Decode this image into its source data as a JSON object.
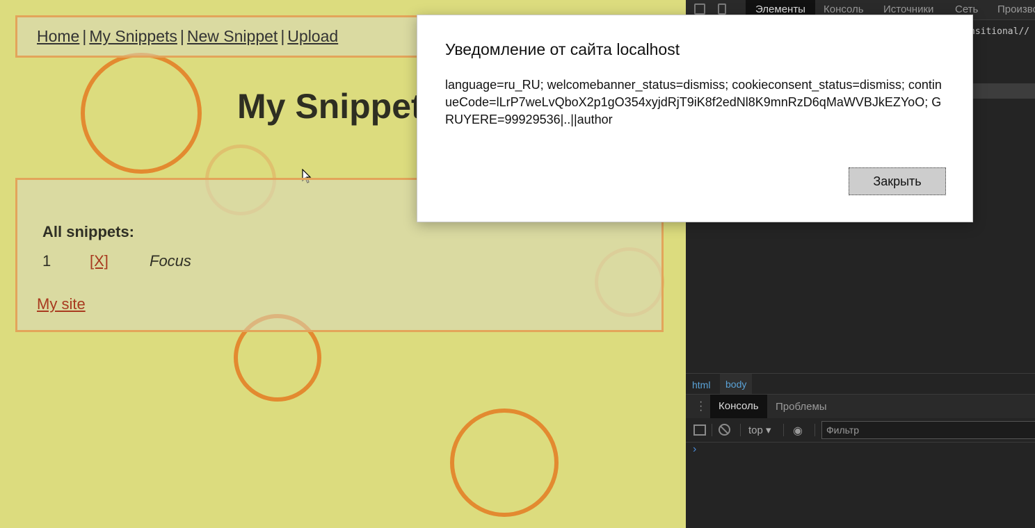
{
  "page": {
    "nav": {
      "home": "Home",
      "my_snippets": "My Snippets",
      "new_snippet": "New Snippet",
      "upload": "Upload",
      "separator": "|"
    },
    "title": "My Snippet",
    "snippets": {
      "heading": "All snippets:",
      "items": [
        {
          "number": "1",
          "delete_label": "[X]",
          "text": "Focus"
        }
      ]
    },
    "footer_link": "My site"
  },
  "dialog": {
    "title": "Уведомление от сайта localhost",
    "message": "language=ru_RU; welcomebanner_status=dismiss; cookieconsent_status=dismiss; continueCode=lLrP7weLvQboX2p1gO354xyjdRjT9iK8f2edNl8K9mnRzD6qMaWVBJkEZYoO; GRUYERE=99929536|..||author",
    "close_button": "Закрыть"
  },
  "devtools": {
    "tabs": [
      "Элементы",
      "Консоль",
      "Источники",
      "Сеть",
      "Произво"
    ],
    "code_fragment": "nsitional//",
    "breadcrumbs": [
      "html",
      "body"
    ],
    "drawer_tabs": [
      "Консоль",
      "Проблемы"
    ],
    "context": "top",
    "filter_placeholder": "Фильтр"
  },
  "colors": {
    "page_background": "#dcdc7e",
    "ring": "#e38a30",
    "panel_border": "#e3a45a",
    "link_red": "#a83a1f",
    "devtools_bg": "#242424",
    "devtools_link": "#5aa2d6"
  }
}
